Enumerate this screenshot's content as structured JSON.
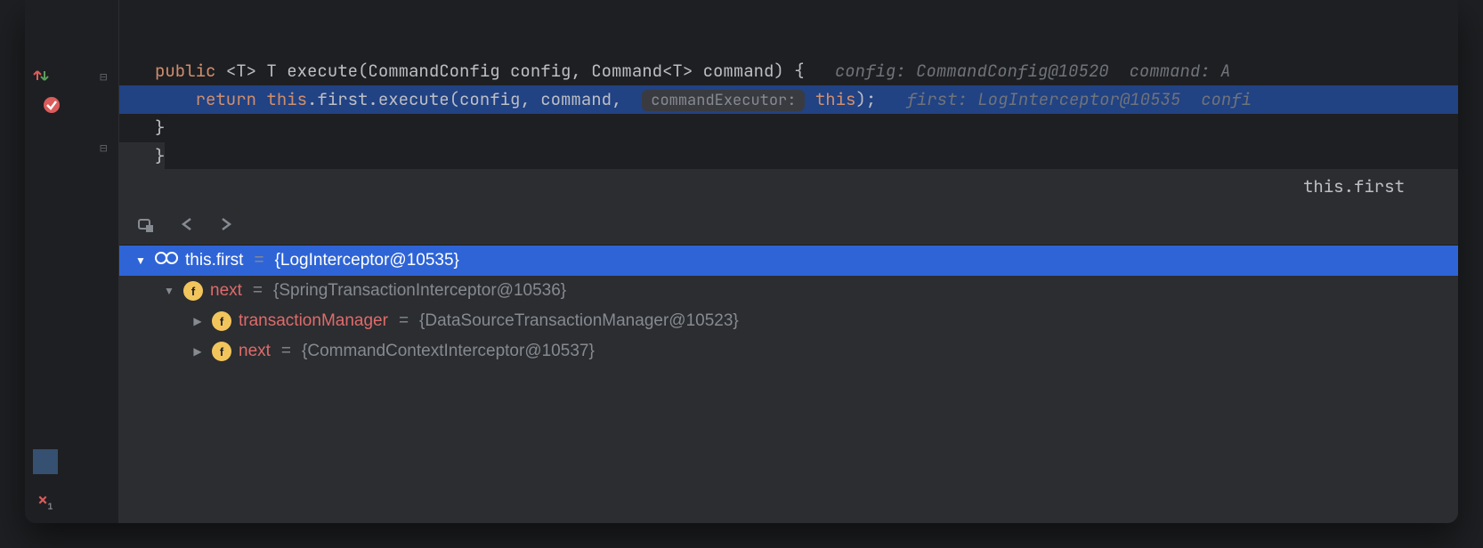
{
  "code": {
    "line1": {
      "kw_public": "public",
      "generic": "<T> T ",
      "method": "execute",
      "params": "(CommandConfig config, Command<T> command) {",
      "hint": "config: CommandConfig@10520  command: A"
    },
    "line2": {
      "kw_return": "return",
      "this": "this",
      "chain": ".first.execute(config, command, ",
      "param_hint": "commandExecutor:",
      "this2": "this",
      "end": ");",
      "hint": "first: LogInterceptor@10535  confi"
    },
    "line3": "}",
    "line4": "}"
  },
  "debug": {
    "header": "this.first",
    "tree": {
      "root": {
        "name": "this.first",
        "value": "{LogInterceptor@10535}"
      },
      "child1": {
        "name": "next",
        "value": "{SpringTransactionInterceptor@10536}"
      },
      "child2": {
        "name": "transactionManager",
        "value": "{DataSourceTransactionManager@10523}"
      },
      "child3": {
        "name": "next",
        "value": "{CommandContextInterceptor@10537}"
      }
    }
  },
  "icons": {
    "field_letter": "f"
  }
}
